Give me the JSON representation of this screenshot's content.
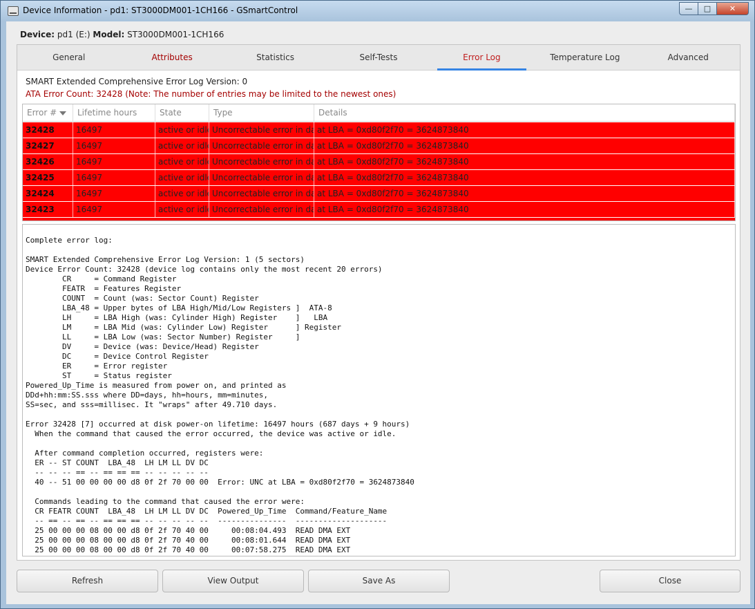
{
  "window": {
    "title": "Device Information - pd1: ST3000DM001-1CH166 - GSmartControl"
  },
  "device": {
    "device_label": "Device:",
    "device_value": "pd1 (E:)",
    "model_label": "Model:",
    "model_value": "ST3000DM001-1CH166"
  },
  "tabs": [
    {
      "label": "General"
    },
    {
      "label": "Attributes"
    },
    {
      "label": "Statistics"
    },
    {
      "label": "Self-Tests"
    },
    {
      "label": "Error Log"
    },
    {
      "label": "Temperature Log"
    },
    {
      "label": "Advanced"
    }
  ],
  "summary": {
    "version_line": "SMART Extended Comprehensive Error Log Version: 0",
    "count_line": "ATA Error Count: 32428 (Note: The number of entries may be limited to the newest ones)"
  },
  "table": {
    "headers": [
      "Error #",
      "Lifetime hours",
      "State",
      "Type",
      "Details"
    ],
    "rows": [
      [
        "32428",
        "16497",
        "active or idle",
        "Uncorrectable error in data",
        "at LBA = 0xd80f2f70 = 3624873840"
      ],
      [
        "32427",
        "16497",
        "active or idle",
        "Uncorrectable error in data",
        "at LBA = 0xd80f2f70 = 3624873840"
      ],
      [
        "32426",
        "16497",
        "active or idle",
        "Uncorrectable error in data",
        "at LBA = 0xd80f2f70 = 3624873840"
      ],
      [
        "32425",
        "16497",
        "active or idle",
        "Uncorrectable error in data",
        "at LBA = 0xd80f2f70 = 3624873840"
      ],
      [
        "32424",
        "16497",
        "active or idle",
        "Uncorrectable error in data",
        "at LBA = 0xd80f2f70 = 3624873840"
      ],
      [
        "32423",
        "16497",
        "active or idle",
        "Uncorrectable error in data",
        "at LBA = 0xd80f2f70 = 3624873840"
      ]
    ]
  },
  "log_text": "Complete error log:\n\nSMART Extended Comprehensive Error Log Version: 1 (5 sectors)\nDevice Error Count: 32428 (device log contains only the most recent 20 errors)\n        CR     = Command Register\n        FEATR  = Features Register\n        COUNT  = Count (was: Sector Count) Register\n        LBA_48 = Upper bytes of LBA High/Mid/Low Registers ]  ATA-8\n        LH     = LBA High (was: Cylinder High) Register    ]   LBA\n        LM     = LBA Mid (was: Cylinder Low) Register      ] Register\n        LL     = LBA Low (was: Sector Number) Register     ]\n        DV     = Device (was: Device/Head) Register\n        DC     = Device Control Register\n        ER     = Error register\n        ST     = Status register\nPowered_Up_Time is measured from power on, and printed as\nDDd+hh:mm:SS.sss where DD=days, hh=hours, mm=minutes,\nSS=sec, and sss=millisec. It \"wraps\" after 49.710 days.\n\nError 32428 [7] occurred at disk power-on lifetime: 16497 hours (687 days + 9 hours)\n  When the command that caused the error occurred, the device was active or idle.\n\n  After command completion occurred, registers were:\n  ER -- ST COUNT  LBA_48  LH LM LL DV DC\n  -- -- -- == -- == == == -- -- -- -- --\n  40 -- 51 00 00 00 00 d8 0f 2f 70 00 00  Error: UNC at LBA = 0xd80f2f70 = 3624873840\n\n  Commands leading to the command that caused the error were:\n  CR FEATR COUNT  LBA_48  LH LM LL DV DC  Powered_Up_Time  Command/Feature_Name\n  -- == -- == -- == == == -- -- -- -- --  ---------------  --------------------\n  25 00 00 00 08 00 00 d8 0f 2f 70 40 00     00:08:04.493  READ DMA EXT\n  25 00 00 00 08 00 00 d8 0f 2f 70 40 00     00:08:01.644  READ DMA EXT\n  25 00 00 00 08 00 00 d8 0f 2f 70 40 00     00:07:58.275  READ DMA EXT",
  "buttons": {
    "refresh": "Refresh",
    "view_output": "View Output",
    "save_as": "Save As",
    "close": "Close"
  },
  "colors": {
    "error_row": "#ff0000",
    "active_tab": "#c01c1c",
    "accent": "#3584e4"
  }
}
